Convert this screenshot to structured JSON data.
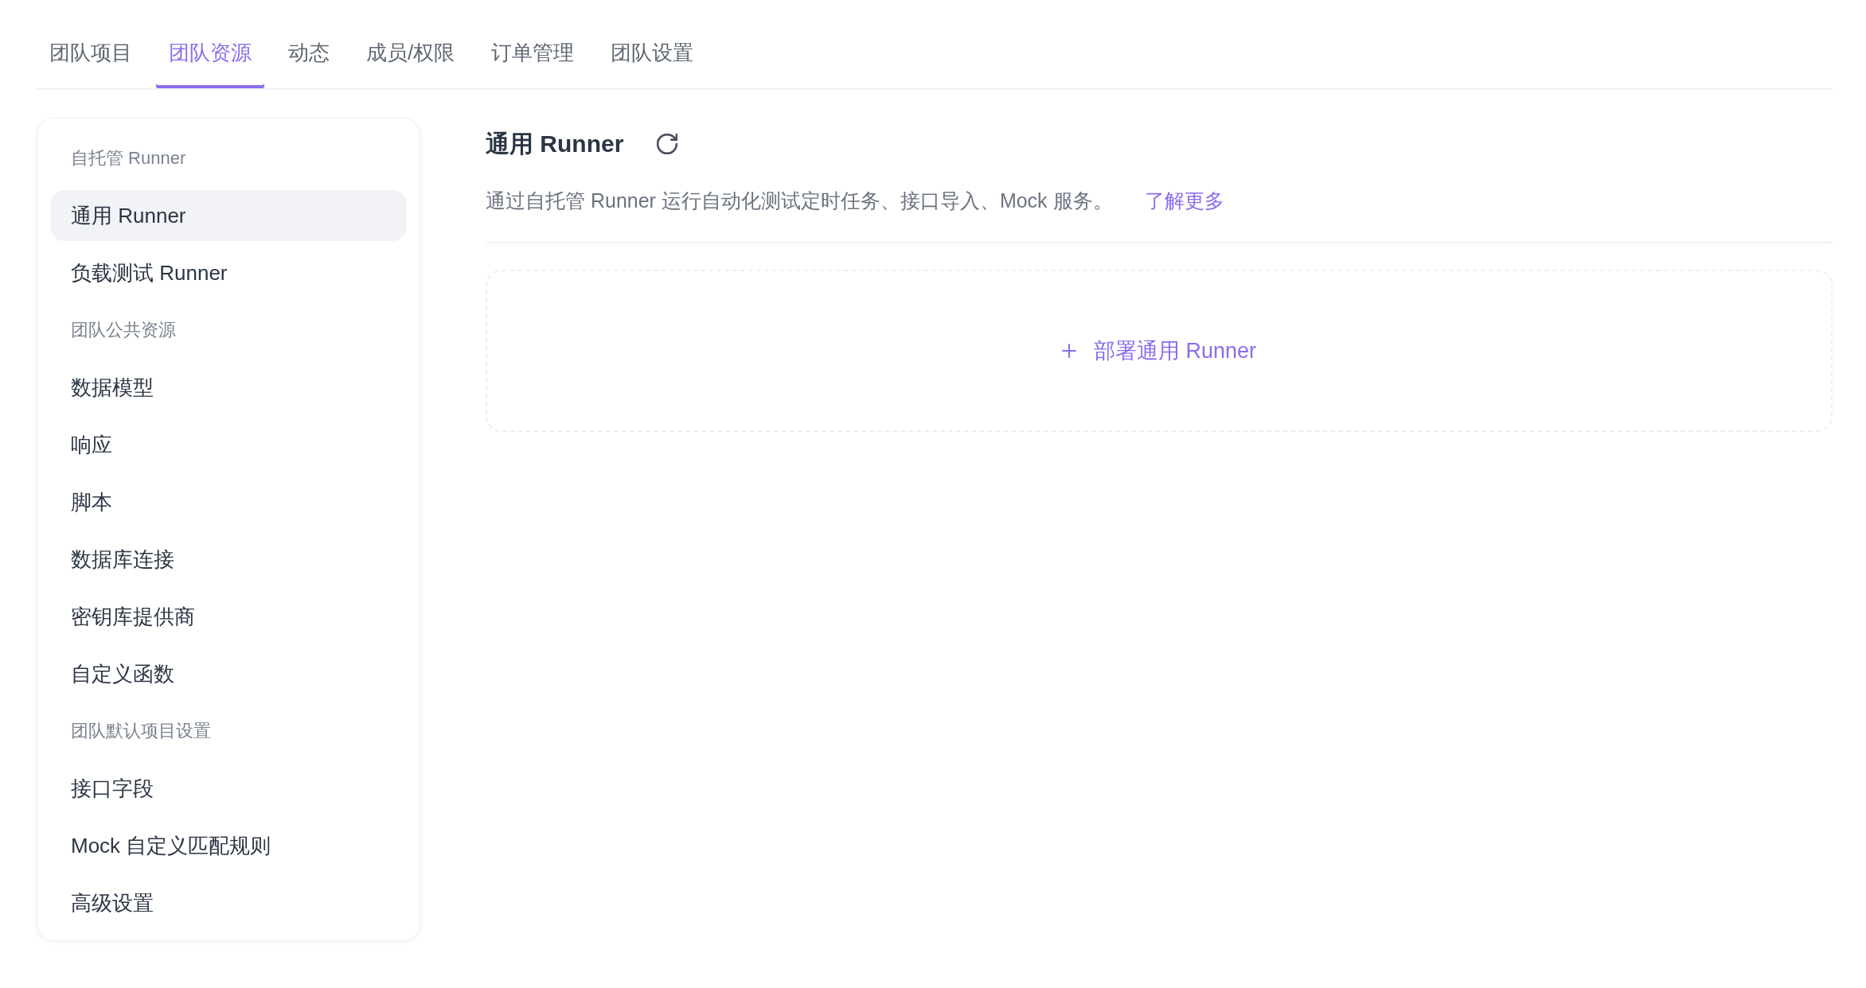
{
  "tabs": [
    {
      "label": "团队项目",
      "selected": false
    },
    {
      "label": "团队资源",
      "selected": true
    },
    {
      "label": "动态",
      "selected": false
    },
    {
      "label": "成员/权限",
      "selected": false
    },
    {
      "label": "订单管理",
      "selected": false
    },
    {
      "label": "团队设置",
      "selected": false
    }
  ],
  "sidebar": {
    "sections": [
      {
        "title": "自托管 Runner",
        "items": [
          {
            "label": "通用 Runner",
            "selected": true
          },
          {
            "label": "负载测试 Runner",
            "selected": false
          }
        ]
      },
      {
        "title": "团队公共资源",
        "items": [
          {
            "label": "数据模型",
            "selected": false
          },
          {
            "label": "响应",
            "selected": false
          },
          {
            "label": "脚本",
            "selected": false
          },
          {
            "label": "数据库连接",
            "selected": false
          },
          {
            "label": "密钥库提供商",
            "selected": false
          },
          {
            "label": "自定义函数",
            "selected": false
          }
        ]
      },
      {
        "title": "团队默认项目设置",
        "items": [
          {
            "label": "接口字段",
            "selected": false
          },
          {
            "label": "Mock 自定义匹配规则",
            "selected": false
          },
          {
            "label": "高级设置",
            "selected": false
          }
        ]
      }
    ]
  },
  "main": {
    "title": "通用 Runner",
    "description": "通过自托管 Runner 运行自动化测试定时任务、接口导入、Mock 服务。",
    "learn_more_link": "了解更多",
    "deploy_button": "部署通用 Runner"
  }
}
